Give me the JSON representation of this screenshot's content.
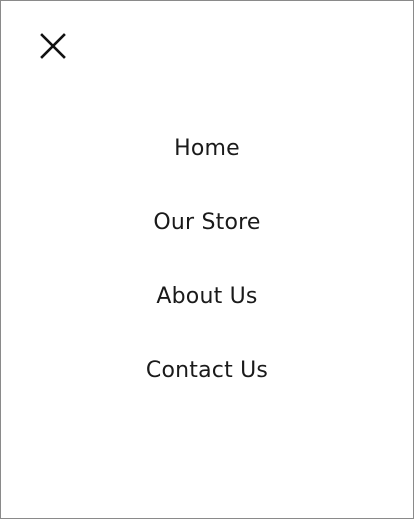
{
  "menu": {
    "close_icon": "close-icon",
    "text_color": "#1a1a1a",
    "border_color": "#8a8a8a",
    "items": [
      {
        "label": "Home"
      },
      {
        "label": "Our Store"
      },
      {
        "label": "About Us"
      },
      {
        "label": "Contact Us"
      }
    ]
  }
}
